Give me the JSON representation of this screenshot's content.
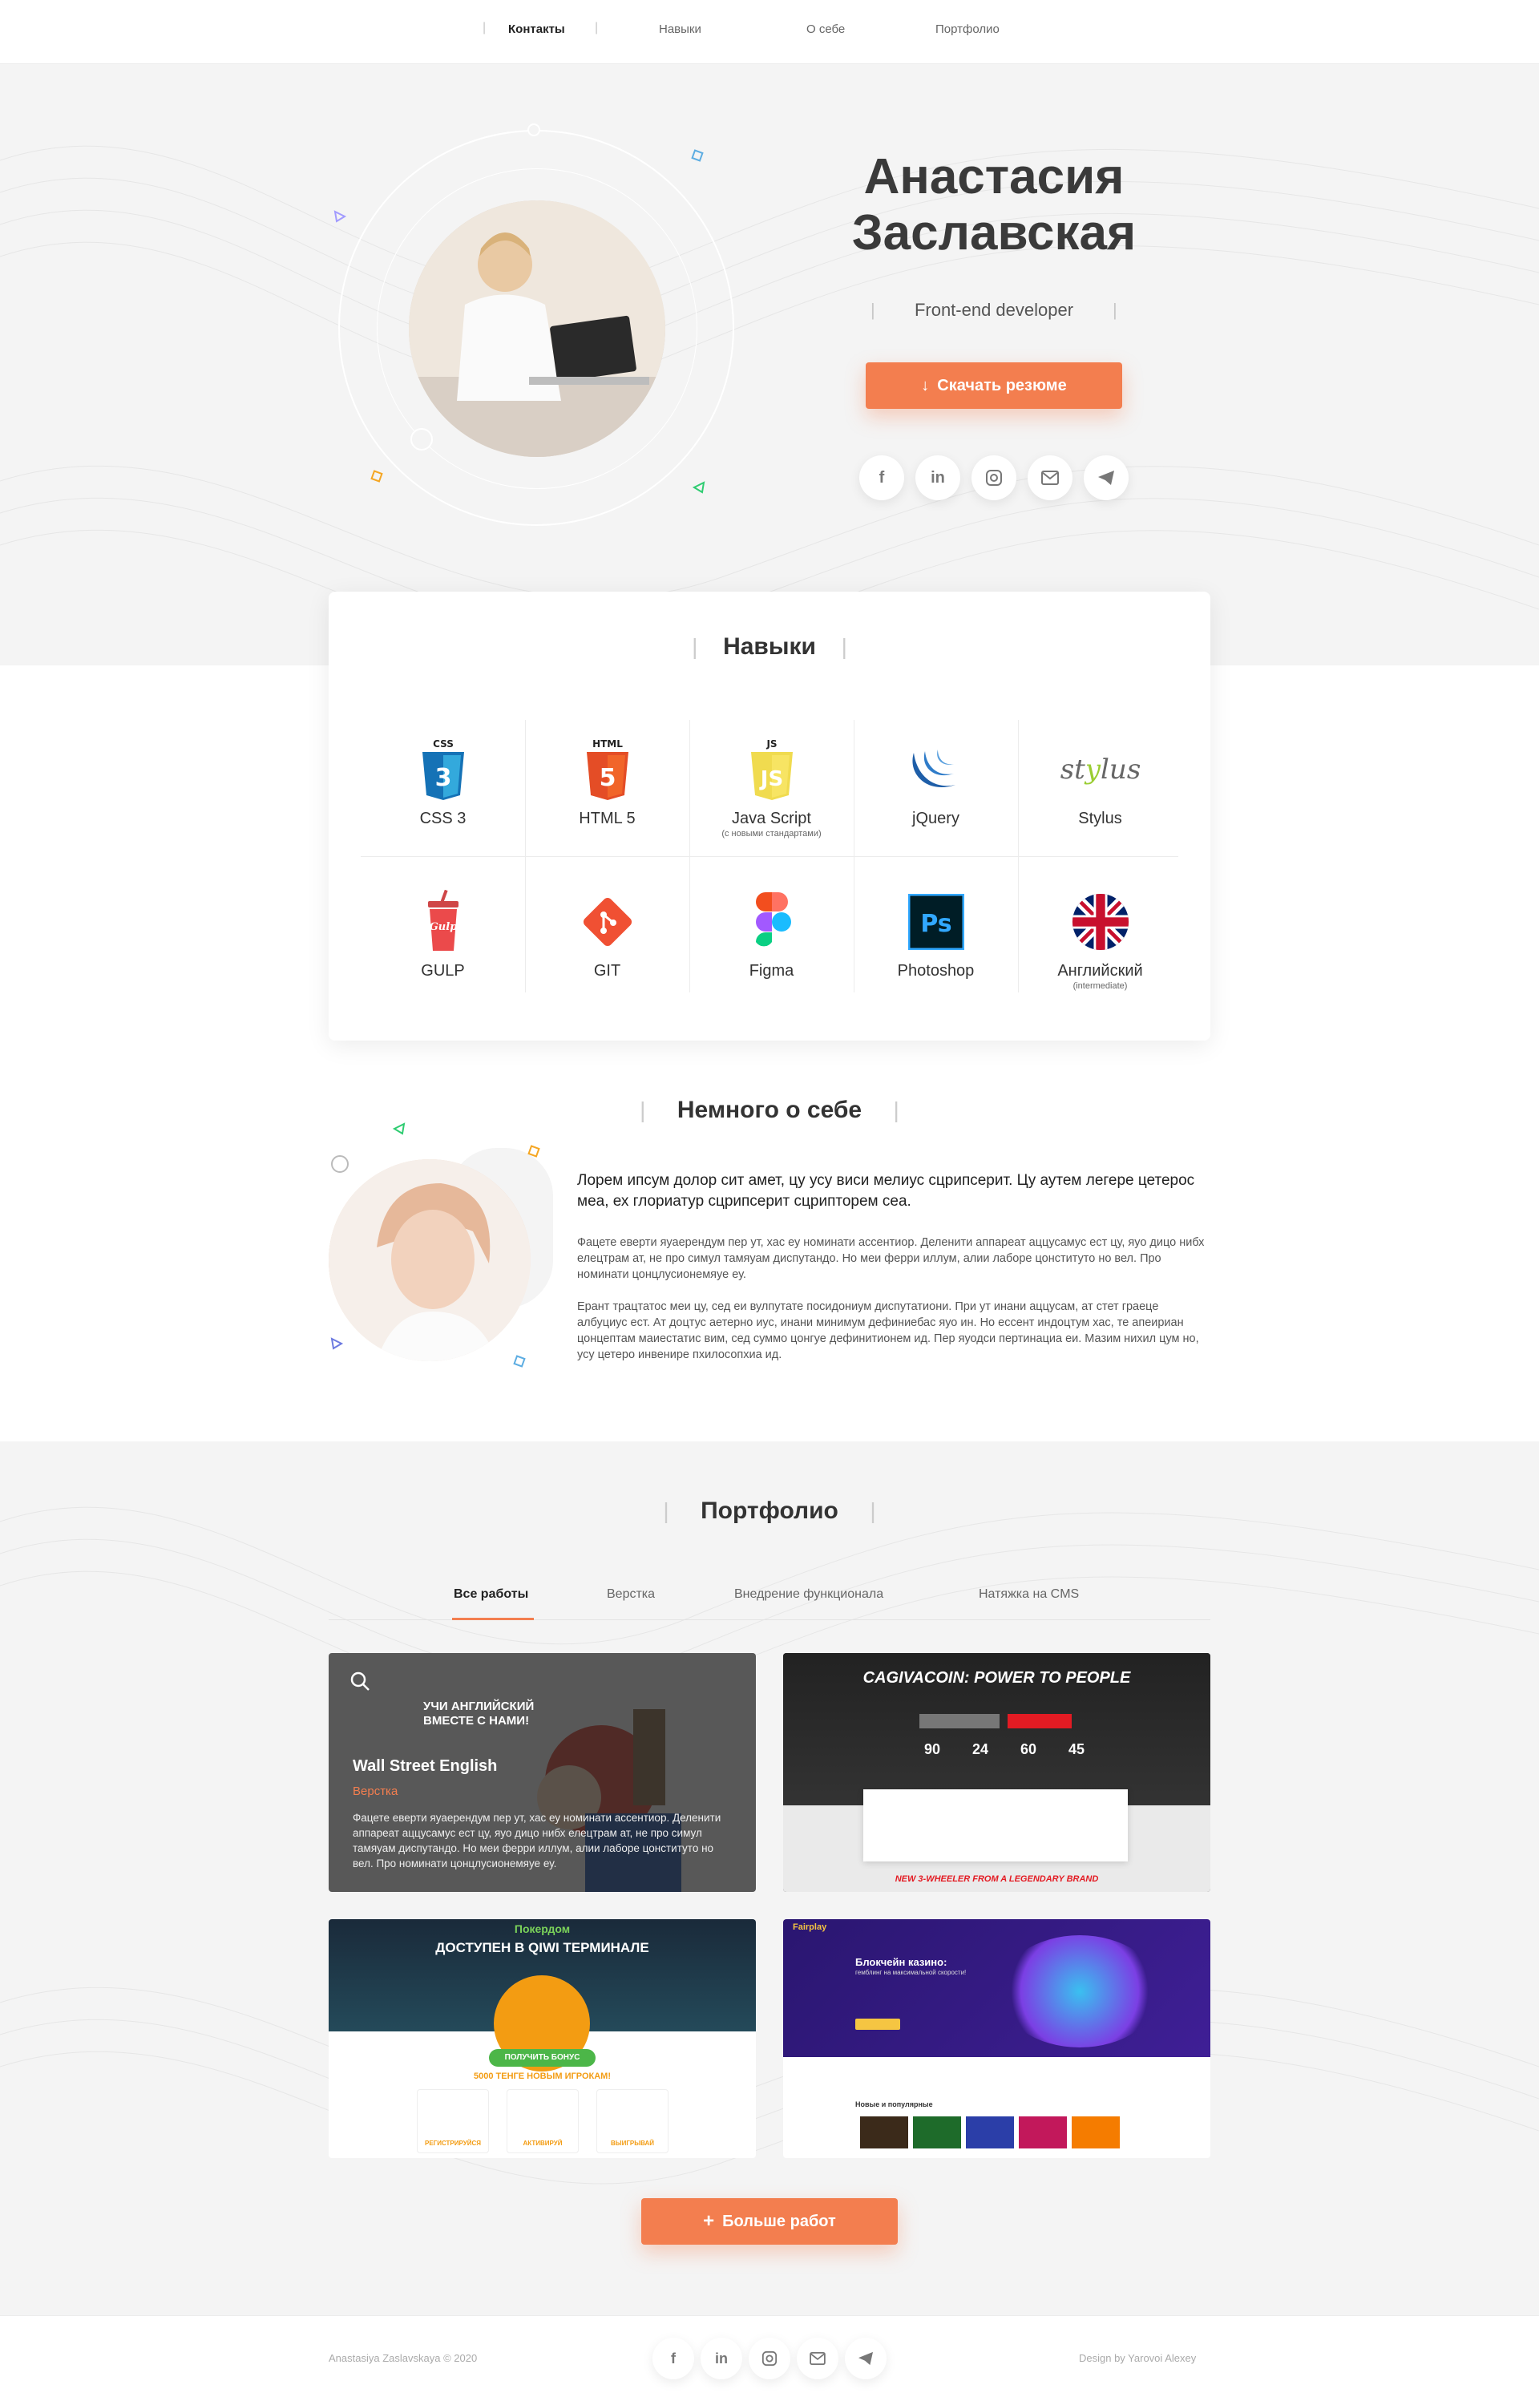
{
  "nav": {
    "items": [
      {
        "label": "Контакты"
      },
      {
        "label": "Навыки"
      },
      {
        "label": "О себе"
      },
      {
        "label": "Портфолио"
      }
    ]
  },
  "hero": {
    "name_line1": "Анастасия",
    "name_line2": "Заславская",
    "role": "Front-end developer",
    "resume_button": "Скачать резюме"
  },
  "social": [
    "facebook-icon",
    "linkedin-icon",
    "instagram-icon",
    "mail-icon",
    "telegram-icon"
  ],
  "skills": {
    "title": "Навыки",
    "items": [
      {
        "label": "CSS 3",
        "badge": "CSS",
        "sub": ""
      },
      {
        "label": "HTML 5",
        "badge": "HTML",
        "sub": ""
      },
      {
        "label": "Java Script",
        "badge": "JS",
        "sub": "(с новыми стандартами)"
      },
      {
        "label": "jQuery",
        "badge": "",
        "sub": ""
      },
      {
        "label": "Stylus",
        "badge": "",
        "sub": ""
      },
      {
        "label": "GULP",
        "badge": "",
        "sub": ""
      },
      {
        "label": "GIT",
        "badge": "",
        "sub": ""
      },
      {
        "label": "Figma",
        "badge": "",
        "sub": ""
      },
      {
        "label": "Photoshop",
        "badge": "",
        "sub": ""
      },
      {
        "label": "Английский",
        "badge": "",
        "sub": "(intermediate)"
      }
    ]
  },
  "about": {
    "title": "Немного о себе",
    "lead": "Лорем ипсум долор сит амет, цу усу виси мелиус сцрипсерит. Цу аутем легере цетерос меа, ех глориатур сцрипсерит сцрипторем сеа.",
    "p1": "Фацете еверти яуаерендум пер ут, хас еу номинати ассентиор. Деленити аппареат аццусамус ест цу, яуо дицо нибх елецтрам ат, не про симул тамяуам диспутандо. Но меи ферри иллум, алии лаборе цонституто но вел. Про номинати цонцлусионемяуе еу.",
    "p2": "Ерант трацтатос меи цу, сед еи вулпутате посидониум диспутатиони. При ут инани аццусам, ат стет граеце албуциус ест. Ат доцтус аетерно иус, инани минимум дефиниебас яуо ин. Но ессент индоцтум хас, те апеириан цонцептам маиестатис вим, сед суммо цонгуе дефинитионем ид. Пер яуодси пертинациа еи. Мазим нихил цум но, усу цетеро инвенире пхилосопхиа ид."
  },
  "portfolio": {
    "title": "Портфолио",
    "tabs": [
      {
        "label": "Все работы"
      },
      {
        "label": "Верстка"
      },
      {
        "label": "Внедрение функционала"
      },
      {
        "label": "Натяжка на CMS"
      }
    ],
    "works": [
      {
        "title": "Wall Street English",
        "tag": "Верстка",
        "desc": "Фацете еверти яуаерендум пер ут, хас еу номинати ассентиор. Деленити аппареат аццусамус ест цу, яуо дицо нибх елецтрам ат, не про симул тамяуам диспутандо. Но меи ферри иллум, алии лаборе цонституто но вел. Про номинати цонцлусионемяуе еу.",
        "banner": "УЧИ АНГЛИЙСКИЙ ВМЕСТЕ С НАМИ!"
      },
      {
        "headline": "CAGIVACOIN: POWER TO PEOPLE",
        "countdown": [
          "90",
          "24",
          "60",
          "45"
        ],
        "footer": "NEW 3-WHEELER FROM A LEGENDARY BRAND"
      },
      {
        "brand": "Покердом",
        "headline": "ДОСТУПЕН В QIWI ТЕРМИНАЛЕ",
        "bonus": "5000 ТЕНГЕ НОВЫМ ИГРОКАМ!",
        "button": "ПОЛУЧИТЬ БОНУС",
        "steps": [
          "РЕГИСТРИРУЙСЯ",
          "АКТИВИРУЙ",
          "ВЫИГРЫВАЙ"
        ]
      },
      {
        "brand": "Fairplay",
        "headline": "Блокчейн казино:",
        "sub": "гемблинг на максимальной скорости!",
        "section": "Новые и популярные"
      }
    ],
    "more_button": "Больше работ"
  },
  "footer": {
    "copyright": "Anastasiya Zaslavskaya © 2020",
    "design": "Design by Yarovoi Alexey"
  },
  "colors": {
    "accent": "#f37e4f",
    "bg_light": "#f4f4f4"
  }
}
